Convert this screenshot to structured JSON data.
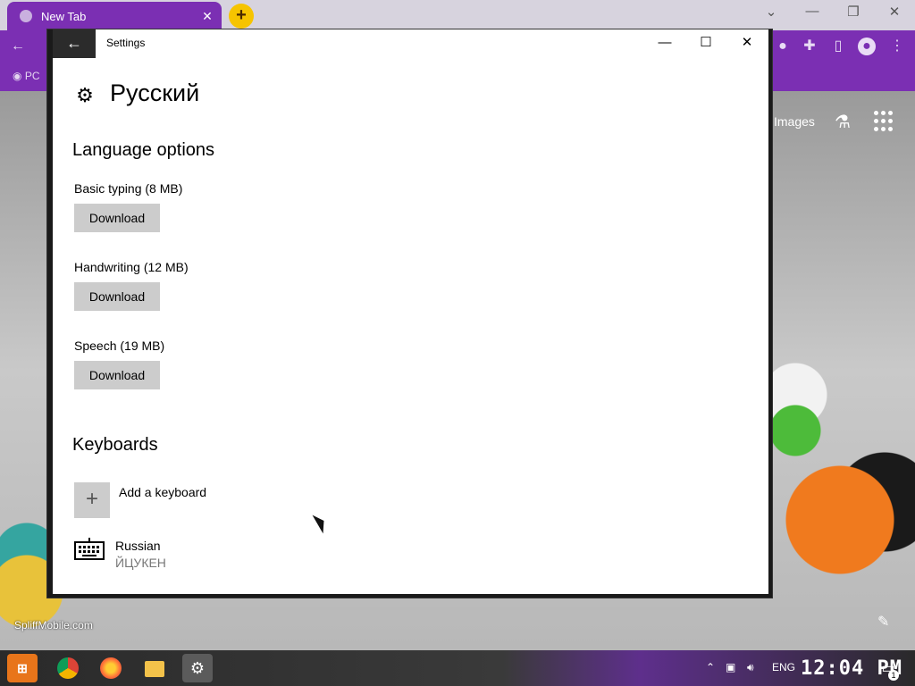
{
  "browser": {
    "tab_title": "New Tab",
    "tab_close": "✕",
    "new_tab_symbol": "+",
    "bookmark_label": "PC",
    "search_images_label": "Images"
  },
  "settings_window": {
    "title": "Settings",
    "back_symbol": "←",
    "minimize_symbol": "—",
    "maximize_symbol": "☐",
    "close_symbol": "✕",
    "page_title": "Русский",
    "language_options": {
      "heading": "Language options",
      "items": [
        {
          "label": "Basic typing (8 MB)",
          "button": "Download"
        },
        {
          "label": "Handwriting (12 MB)",
          "button": "Download"
        },
        {
          "label": "Speech (19 MB)",
          "button": "Download"
        }
      ]
    },
    "keyboards": {
      "heading": "Keyboards",
      "add_label": "Add a keyboard",
      "add_symbol": "+",
      "installed": [
        {
          "name": "Russian",
          "layout": "ЙЦУКЕН"
        }
      ]
    }
  },
  "wallpaper": {
    "watermark": "SpliffMobile.com"
  },
  "taskbar": {
    "language": "ENG",
    "clock": "12:04 PM",
    "notification_count": "1"
  }
}
